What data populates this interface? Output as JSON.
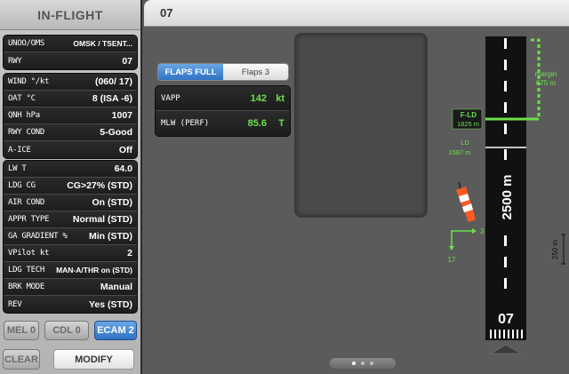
{
  "left_panel": {
    "title": "IN-FLIGHT",
    "group1": [
      {
        "label": "UNOO/OMS",
        "value": "OMSK / TSENT..."
      },
      {
        "label": "RWY",
        "value": "07"
      }
    ],
    "group2": [
      {
        "label": "WIND °/kt",
        "value": "(060/ 17)"
      },
      {
        "label": "OAT °C",
        "value": "8 (ISA -6)"
      },
      {
        "label": "QNH hPa",
        "value": "1007"
      },
      {
        "label": "RWY COND",
        "value": "5-Good"
      },
      {
        "label": "A-ICE",
        "value": "Off"
      }
    ],
    "group3": [
      {
        "label": "LW T",
        "value": "64.0"
      },
      {
        "label": "LDG CG",
        "value": "CG>27% (STD)"
      },
      {
        "label": "AIR COND",
        "value": "On (STD)"
      },
      {
        "label": "APPR TYPE",
        "value": "Normal (STD)"
      },
      {
        "label": "GA GRADIENT %",
        "value": "Min (STD)"
      },
      {
        "label": "VPilot kt",
        "value": "2"
      },
      {
        "label": "LDG TECH",
        "value": "MAN-A/THR on (STD)"
      },
      {
        "label": "BRK MODE",
        "value": "Manual"
      },
      {
        "label": "REV",
        "value": "Yes (STD)"
      }
    ],
    "buttons": {
      "mel": "MEL 0",
      "cdl": "CDL 0",
      "ecam": "ECAM 2",
      "clear": "CLEAR",
      "modify": "MODIFY"
    }
  },
  "main": {
    "runway_header": "07",
    "flaps_tabs": [
      {
        "label": "FLAPS FULL",
        "selected": true
      },
      {
        "label": "Flaps 3",
        "selected": false
      }
    ],
    "perf": [
      {
        "label": "VAPP",
        "value": "142",
        "unit": "kt"
      },
      {
        "label": "MLW (PERF)",
        "value": "85.6",
        "unit": "T"
      }
    ],
    "runway": {
      "length_label": "2500 m",
      "number": "07",
      "margin_label": "margin",
      "margin_value": "675 m",
      "fld_label": "F-LD",
      "fld_value": "1825 m",
      "ld_label": "LD",
      "ld_value": "1587 m",
      "wind_head": "3",
      "wind_cross": "17",
      "scale_label": "250 m"
    },
    "pager": {
      "count": 3,
      "active": 0
    }
  },
  "colors": {
    "accent_blue": "#2f72c4",
    "green": "#6be04a",
    "runway": "#111111"
  }
}
